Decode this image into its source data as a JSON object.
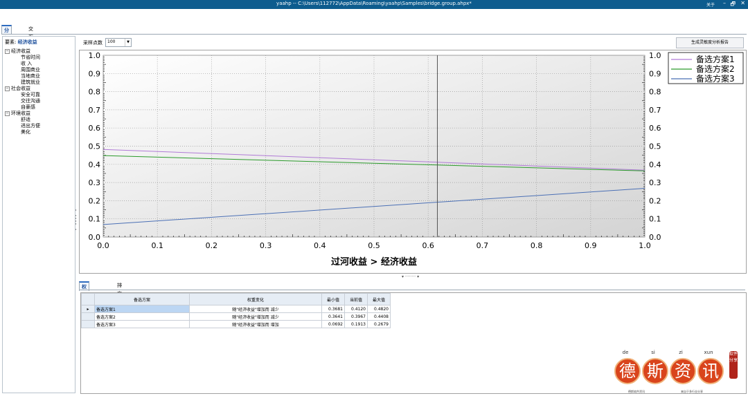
{
  "window": {
    "title": "yaahp -- C:\\Users\\112772\\AppData\\Roaming\\yaahp\\Samples\\bridge.group.ahpx*",
    "about": "关于",
    "minimize": "–",
    "restore": "🗗",
    "close": "✕"
  },
  "tabs": [
    "分析结果",
    "交互分析"
  ],
  "tree": {
    "criterion_label": "要素:",
    "criterion_value": "经济收益",
    "nodes": [
      {
        "label": "经济收益",
        "level": 0,
        "expanded": true
      },
      {
        "label": "节省时间",
        "level": 1
      },
      {
        "label": "收 入",
        "level": 1
      },
      {
        "label": "周围商业",
        "level": 1
      },
      {
        "label": "当地商业",
        "level": 1
      },
      {
        "label": "建筑就业",
        "level": 1
      },
      {
        "label": "社会收益",
        "level": 0,
        "expanded": true
      },
      {
        "label": "安全可靠",
        "level": 1
      },
      {
        "label": "交往沟通",
        "level": 1
      },
      {
        "label": "自豪感",
        "level": 1
      },
      {
        "label": "环境收益",
        "level": 0,
        "expanded": true
      },
      {
        "label": "舒适",
        "level": 1
      },
      {
        "label": "进出方便",
        "level": 1
      },
      {
        "label": "美化",
        "level": 1
      }
    ]
  },
  "toolbar": {
    "sample_label": "采样点数",
    "sample_value": "100",
    "report_button": "生成灵敏度分析报告"
  },
  "chart_data": {
    "type": "line",
    "xlabel": "过河收益 > 经济收益",
    "ylabel": "",
    "xlim": [
      0,
      1
    ],
    "ylim": [
      0,
      1
    ],
    "xticks": [
      "0.0",
      "0.1",
      "0.2",
      "0.3",
      "0.4",
      "0.5",
      "0.6",
      "0.7",
      "0.8",
      "0.9",
      "1.0"
    ],
    "yticks": [
      "0.0",
      "0.1",
      "0.2",
      "0.3",
      "0.4",
      "0.5",
      "0.6",
      "0.7",
      "0.8",
      "0.9",
      "1.0"
    ],
    "grid": true,
    "legend": "top-right",
    "marker_x": 0.617,
    "series": [
      {
        "name": "备选方案1",
        "color": "#b07ad6",
        "x": [
          0,
          1
        ],
        "y": [
          0.482,
          0.368
        ]
      },
      {
        "name": "备选方案2",
        "color": "#2a9a2a",
        "x": [
          0,
          1
        ],
        "y": [
          0.448,
          0.364
        ]
      },
      {
        "name": "备选方案3",
        "color": "#4a6fb5",
        "x": [
          0,
          1
        ],
        "y": [
          0.069,
          0.268
        ]
      }
    ]
  },
  "bottom_tabs": [
    "权重变化情况",
    "排序变化情况"
  ],
  "table": {
    "headers": [
      "备选方案",
      "权重变化",
      "最小值",
      "当前值",
      "最大值"
    ],
    "rows": [
      {
        "name": "备选方案1",
        "change": "随\"经济收益\"增加而 减少",
        "min": "0.3681",
        "cur": "0.4120",
        "max": "0.4820"
      },
      {
        "name": "备选方案2",
        "change": "随\"经济收益\"增加而 减少",
        "min": "0.3641",
        "cur": "0.3967",
        "max": "0.4408"
      },
      {
        "name": "备选方案3",
        "change": "随\"经济收益\"增加而 增加",
        "min": "0.0692",
        "cur": "0.1913",
        "max": "0.2679"
      }
    ]
  },
  "watermark": {
    "pinyin": [
      "de",
      "si",
      "zi",
      "xun"
    ],
    "chars": [
      "德",
      "斯",
      "资",
      "讯"
    ],
    "seal": "软件分享",
    "caption_left": "德斯软件资讯",
    "caption_right": "来自于多行业分享"
  }
}
